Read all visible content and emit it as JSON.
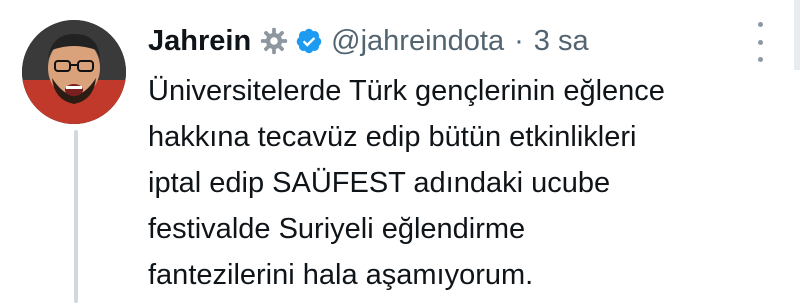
{
  "tweet": {
    "author_name": "Jahrein",
    "handle": "@jahreindota",
    "separator": "·",
    "timestamp": "3 sa",
    "body_lines": [
      "Üniversitelerde Türk gençlerinin eğlence",
      "hakkına tecavüz edip bütün etkinlikleri",
      "iptal edip SAÜFEST adındaki ucube",
      "festivalde Suriyeli eğlendirme",
      "fantezilerini hala aşamıyorum."
    ]
  },
  "icons": {
    "badge_gear": "gear-icon",
    "verified": "verified-icon",
    "more": "more-options-icon"
  },
  "colors": {
    "verified_blue": "#1d9bf0",
    "secondary_text": "#536471",
    "thread_line": "#cfd9de"
  }
}
